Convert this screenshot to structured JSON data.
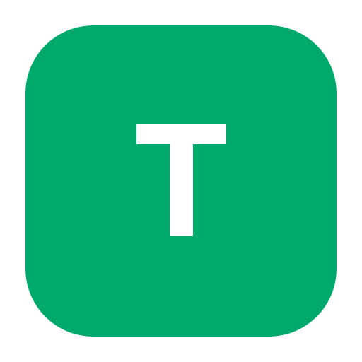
{
  "app_icon": {
    "letter": "T",
    "icon": "letter-t-icon",
    "colors": {
      "tile": "#00AA6C",
      "glyph": "#FFFFFF",
      "background": "#FFFFFF"
    }
  }
}
